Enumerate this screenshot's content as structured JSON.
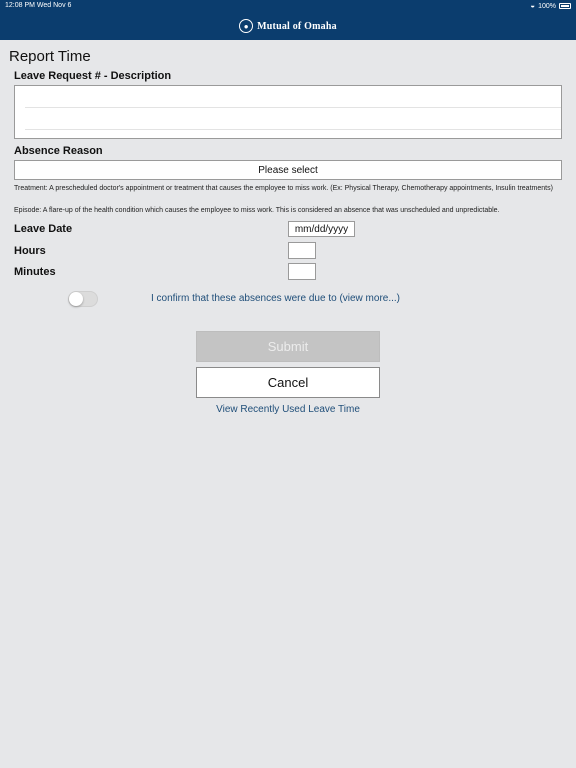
{
  "status_bar": {
    "time": "12:08 PM   Wed Nov 6",
    "battery": "100%"
  },
  "header": {
    "brand": "Mutual of Omaha",
    "logo_icon": "indian-head-icon"
  },
  "page": {
    "title": "Report Time"
  },
  "form": {
    "leave_request_label": "Leave Request # - Description",
    "leave_requests": [],
    "absence_reason_label": "Absence Reason",
    "absence_reason_value": "Please select",
    "treatment_help": "Treatment: A prescheduled doctor's appointment or treatment that causes the employee to miss work. (Ex: Physical Therapy, Chemotherapy appointments, Insulin treatments)",
    "episode_help": "Episode: A flare-up of the health condition which causes the employee to miss work. This is considered an absence that was unscheduled and unpredictable.",
    "leave_date_label": "Leave Date",
    "leave_date_placeholder": "mm/dd/yyyy",
    "hours_label": "Hours",
    "minutes_label": "Minutes",
    "confirm_text": "I confirm that these absences were due to (view more...)",
    "confirm_checked": false
  },
  "actions": {
    "submit_label": "Submit",
    "cancel_label": "Cancel",
    "recent_link": "View Recently Used Leave Time"
  },
  "colors": {
    "nav_bg": "#0b3d6e",
    "page_bg": "#e6e7e9",
    "link": "#1f4e79",
    "submit_disabled_bg": "#c4c4c4"
  }
}
